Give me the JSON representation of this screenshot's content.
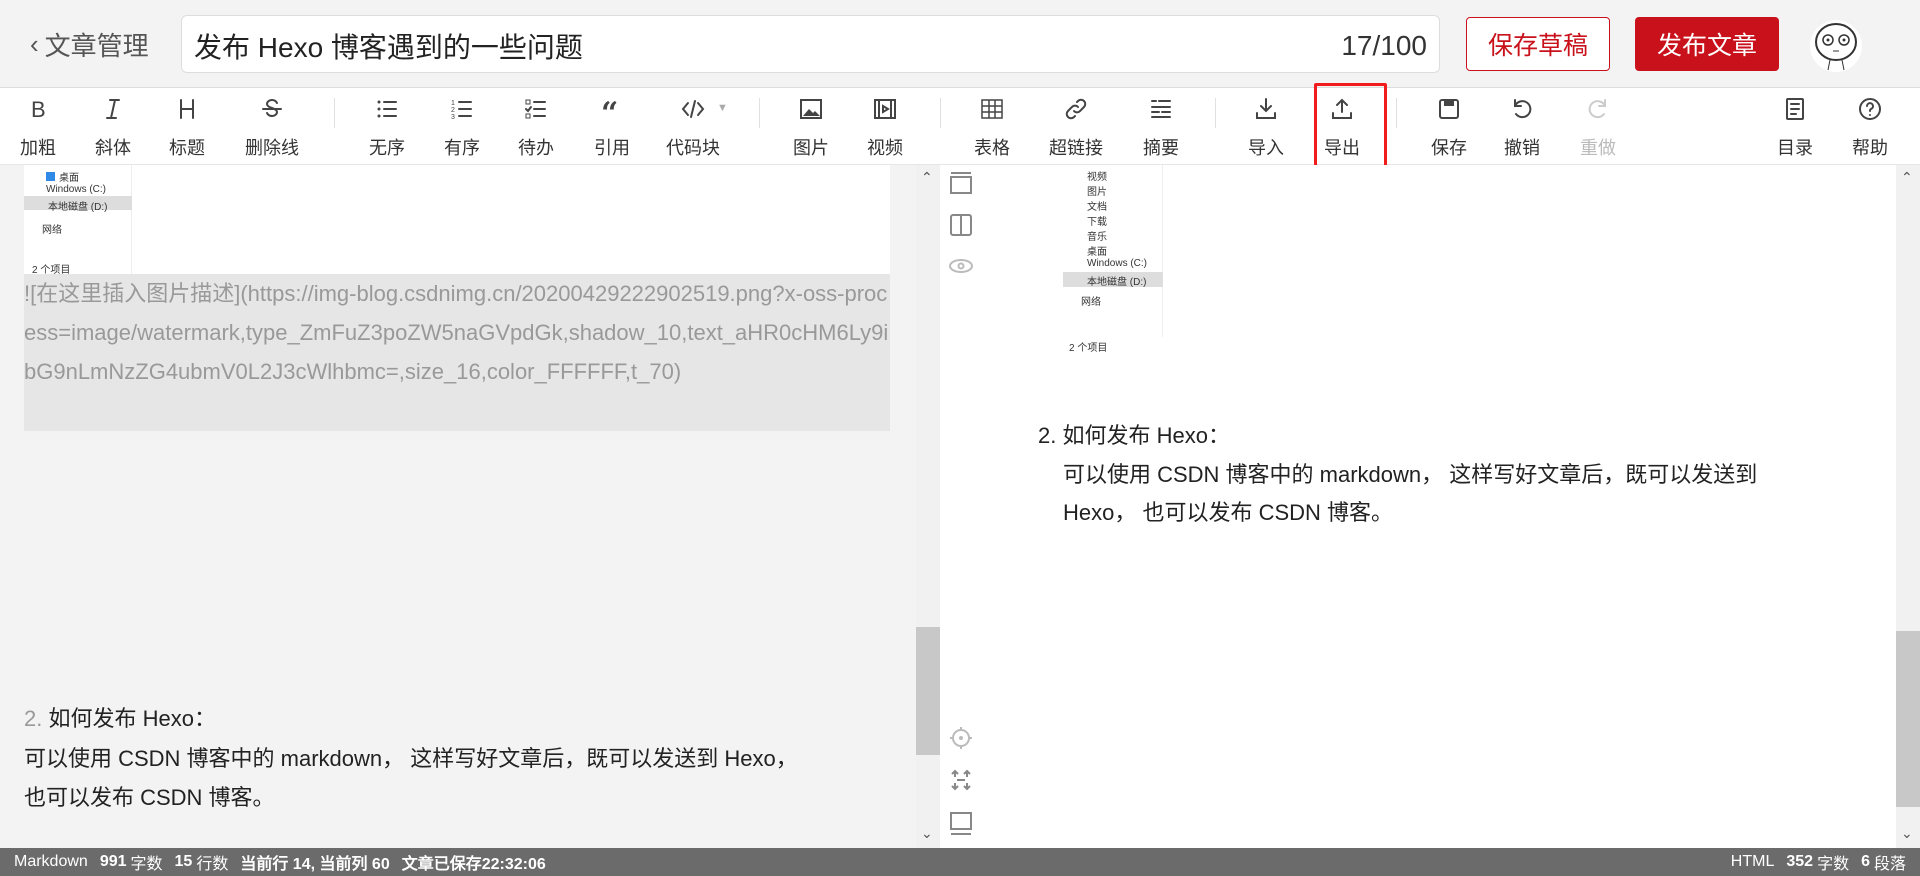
{
  "header": {
    "back_label": "文章管理",
    "title": "发布 Hexo 博客遇到的一些问题",
    "title_count": "17/100",
    "save_draft": "保存草稿",
    "publish": "发布文章"
  },
  "toolbar": {
    "items": [
      {
        "label": "加粗",
        "icon": "bold-icon"
      },
      {
        "label": "斜体",
        "icon": "italic-icon"
      },
      {
        "label": "标题",
        "icon": "heading-icon"
      },
      {
        "label": "删除线",
        "icon": "strikethrough-icon"
      },
      {
        "label": "无序",
        "icon": "unordered-list-icon"
      },
      {
        "label": "有序",
        "icon": "ordered-list-icon"
      },
      {
        "label": "待办",
        "icon": "todo-list-icon"
      },
      {
        "label": "引用",
        "icon": "quote-icon"
      },
      {
        "label": "代码块",
        "icon": "code-icon"
      },
      {
        "label": "图片",
        "icon": "image-icon"
      },
      {
        "label": "视频",
        "icon": "video-icon"
      },
      {
        "label": "表格",
        "icon": "table-icon"
      },
      {
        "label": "超链接",
        "icon": "link-icon"
      },
      {
        "label": "摘要",
        "icon": "summary-icon"
      },
      {
        "label": "导入",
        "icon": "import-icon"
      },
      {
        "label": "导出",
        "icon": "export-icon"
      },
      {
        "label": "保存",
        "icon": "save-icon"
      },
      {
        "label": "撤销",
        "icon": "undo-icon"
      },
      {
        "label": "重做",
        "icon": "redo-icon"
      },
      {
        "label": "目录",
        "icon": "toc-icon"
      },
      {
        "label": "帮助",
        "icon": "help-icon"
      }
    ]
  },
  "screenshot": {
    "nav_left": [
      "桌面",
      "Windows (C:)",
      "本地磁盘 (D:)",
      "网络"
    ],
    "nav_right": [
      "视频",
      "图片",
      "文档",
      "下载",
      "音乐",
      "桌面",
      "Windows (C:)",
      "本地磁盘 (D:)",
      "网络"
    ],
    "items_count": "2 个项目"
  },
  "editor": {
    "image_markdown": "![在这里插入图片描述](https://img-blog.csdnimg.cn/20200429222902519.png?x-oss-process=image/watermark,type_ZmFuZ3poZW5naGVpdGk,shadow_10,text_aHR0cHM6Ly9ibG9nLmNzZG4ubmV0L2J3cWlhbmc=,size_16,color_FFFFFF,t_70)",
    "list_num": "2.",
    "heading": "如何发布 Hexo：",
    "body": "可以使用 CSDN 博客中的 markdown， 这样写好文章后，既可以发送到 Hexo，",
    "body2": "也可以发布 CSDN 博客。"
  },
  "preview": {
    "list_num": "2.",
    "heading": "如何发布 Hexo：",
    "body": "可以使用 CSDN 博客中的 markdown， 这样写好文章后，既可以发送到",
    "body2": "Hexo， 也可以发布 CSDN 博客。"
  },
  "status": {
    "mode": "Markdown",
    "chars": "991",
    "chars_label": "字数",
    "lines": "15",
    "lines_label": "行数",
    "cursor": "当前行 14, 当前列 60",
    "saved": "文章已保存22:32:06",
    "html": "HTML",
    "html_chars": "352",
    "html_chars_label": "字数",
    "paragraphs": "6",
    "paragraphs_label": "段落"
  },
  "colors": {
    "accent": "#c9111b",
    "highlight": "#f21c1c"
  }
}
